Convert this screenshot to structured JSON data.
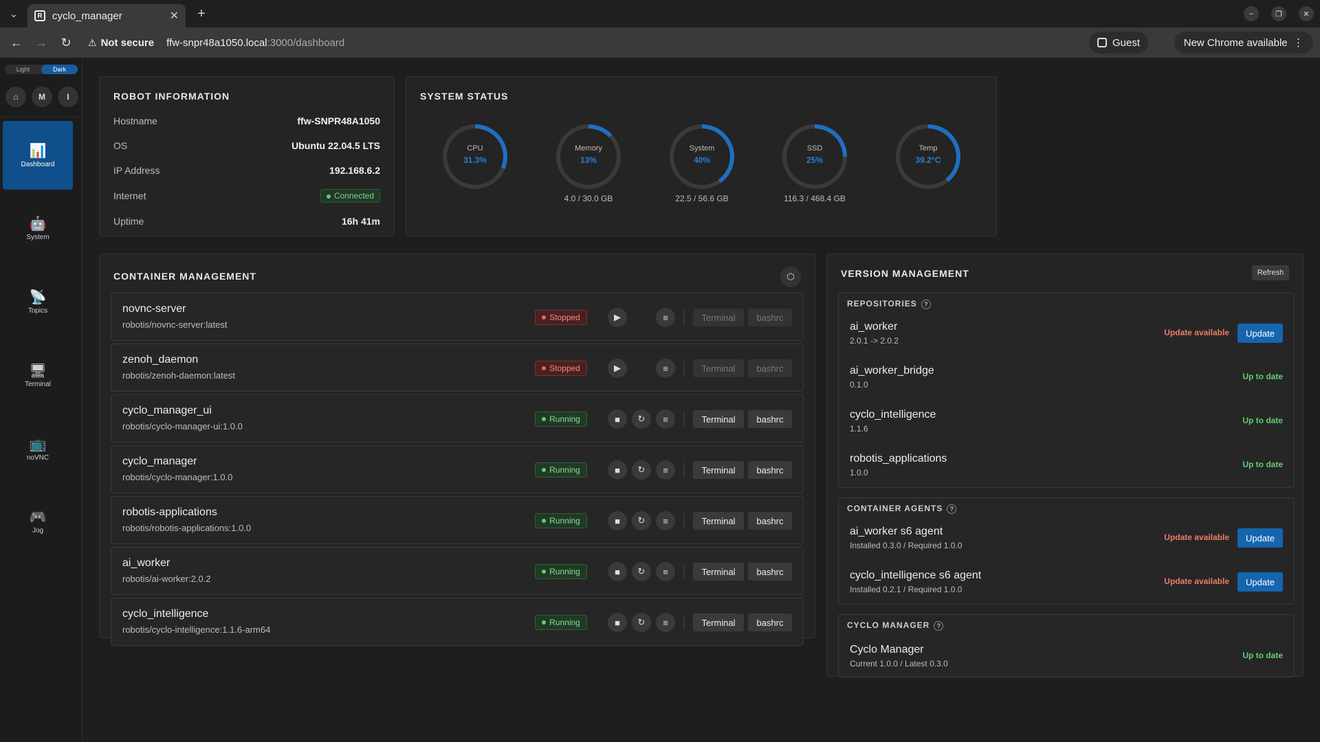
{
  "browser": {
    "tab_title": "cyclo_manager",
    "security": "Not secure",
    "url_host": "ffw-snpr48a1050.local",
    "url_rest": ":3000/dashboard",
    "profile": "Guest",
    "update_notice": "New Chrome available"
  },
  "sidebar": {
    "theme_light": "Light",
    "theme_dark": "Dark",
    "circles": [
      "M",
      "I"
    ],
    "items": [
      {
        "label": "Dashboard",
        "icon": "📊"
      },
      {
        "label": "System",
        "icon": "🤖"
      },
      {
        "label": "Topics",
        "icon": "📡"
      },
      {
        "label": "Terminal",
        "icon": "🖥"
      },
      {
        "label": "noVNC",
        "icon": "📺"
      },
      {
        "label": "Jog",
        "icon": "🎮"
      }
    ]
  },
  "robot_info": {
    "title": "ROBOT INFORMATION",
    "rows": [
      {
        "label": "Hostname",
        "value": "ffw-SNPR48A1050"
      },
      {
        "label": "OS",
        "value": "Ubuntu 22.04.5 LTS"
      },
      {
        "label": "IP Address",
        "value": "192.168.6.2"
      },
      {
        "label": "Internet",
        "value": "Connected"
      },
      {
        "label": "Uptime",
        "value": "16h 41m"
      }
    ]
  },
  "system_status": {
    "title": "SYSTEM STATUS",
    "gauges": [
      {
        "label": "CPU",
        "value": "31.3%",
        "pct": 31.3,
        "sub": ""
      },
      {
        "label": "Memory",
        "value": "13%",
        "pct": 13,
        "sub": "4.0 / 30.0 GB"
      },
      {
        "label": "System",
        "value": "40%",
        "pct": 40,
        "sub": "22.5 / 56.6 GB"
      },
      {
        "label": "SSD",
        "value": "25%",
        "pct": 25,
        "sub": "116.3 / 468.4 GB"
      },
      {
        "label": "Temp",
        "value": "39.2°C",
        "pct": 39.2,
        "sub": ""
      }
    ]
  },
  "containers": {
    "title": "CONTAINER MANAGEMENT",
    "terminal_label": "Terminal",
    "bashrc_label": "bashrc",
    "items": [
      {
        "name": "novnc-server",
        "image": "robotis/novnc-server:latest",
        "status": "Stopped"
      },
      {
        "name": "zenoh_daemon",
        "image": "robotis/zenoh-daemon:latest",
        "status": "Stopped"
      },
      {
        "name": "cyclo_manager_ui",
        "image": "robotis/cyclo-manager-ui:1.0.0",
        "status": "Running"
      },
      {
        "name": "cyclo_manager",
        "image": "robotis/cyclo-manager:1.0.0",
        "status": "Running"
      },
      {
        "name": "robotis-applications",
        "image": "robotis/robotis-applications:1.0.0",
        "status": "Running"
      },
      {
        "name": "ai_worker",
        "image": "robotis/ai-worker:2.0.2",
        "status": "Running"
      },
      {
        "name": "cyclo_intelligence",
        "image": "robotis/cyclo-intelligence:1.1.6-arm64",
        "status": "Running"
      }
    ]
  },
  "versions": {
    "title": "VERSION MANAGEMENT",
    "refresh_label": "Refresh",
    "update_label": "Update",
    "update_available": "Update available",
    "up_to_date": "Up to date",
    "repositories": {
      "title": "REPOSITORIES",
      "items": [
        {
          "name": "ai_worker",
          "sub": "2.0.1 -> 2.0.2",
          "state": "update"
        },
        {
          "name": "ai_worker_bridge",
          "sub": "0.1.0",
          "state": "ok"
        },
        {
          "name": "cyclo_intelligence",
          "sub": "1.1.6",
          "state": "ok"
        },
        {
          "name": "robotis_applications",
          "sub": "1.0.0",
          "state": "ok"
        }
      ]
    },
    "agents": {
      "title": "CONTAINER AGENTS",
      "items": [
        {
          "name": "ai_worker s6 agent",
          "sub": "Installed 0.3.0 / Required 1.0.0",
          "state": "update"
        },
        {
          "name": "cyclo_intelligence s6 agent",
          "sub": "Installed 0.2.1 / Required 1.0.0",
          "state": "update"
        }
      ]
    },
    "manager": {
      "title": "CYCLO MANAGER",
      "items": [
        {
          "name": "Cyclo Manager",
          "sub": "Current 1.0.0 / Latest 0.3.0",
          "state": "ok"
        }
      ]
    }
  }
}
